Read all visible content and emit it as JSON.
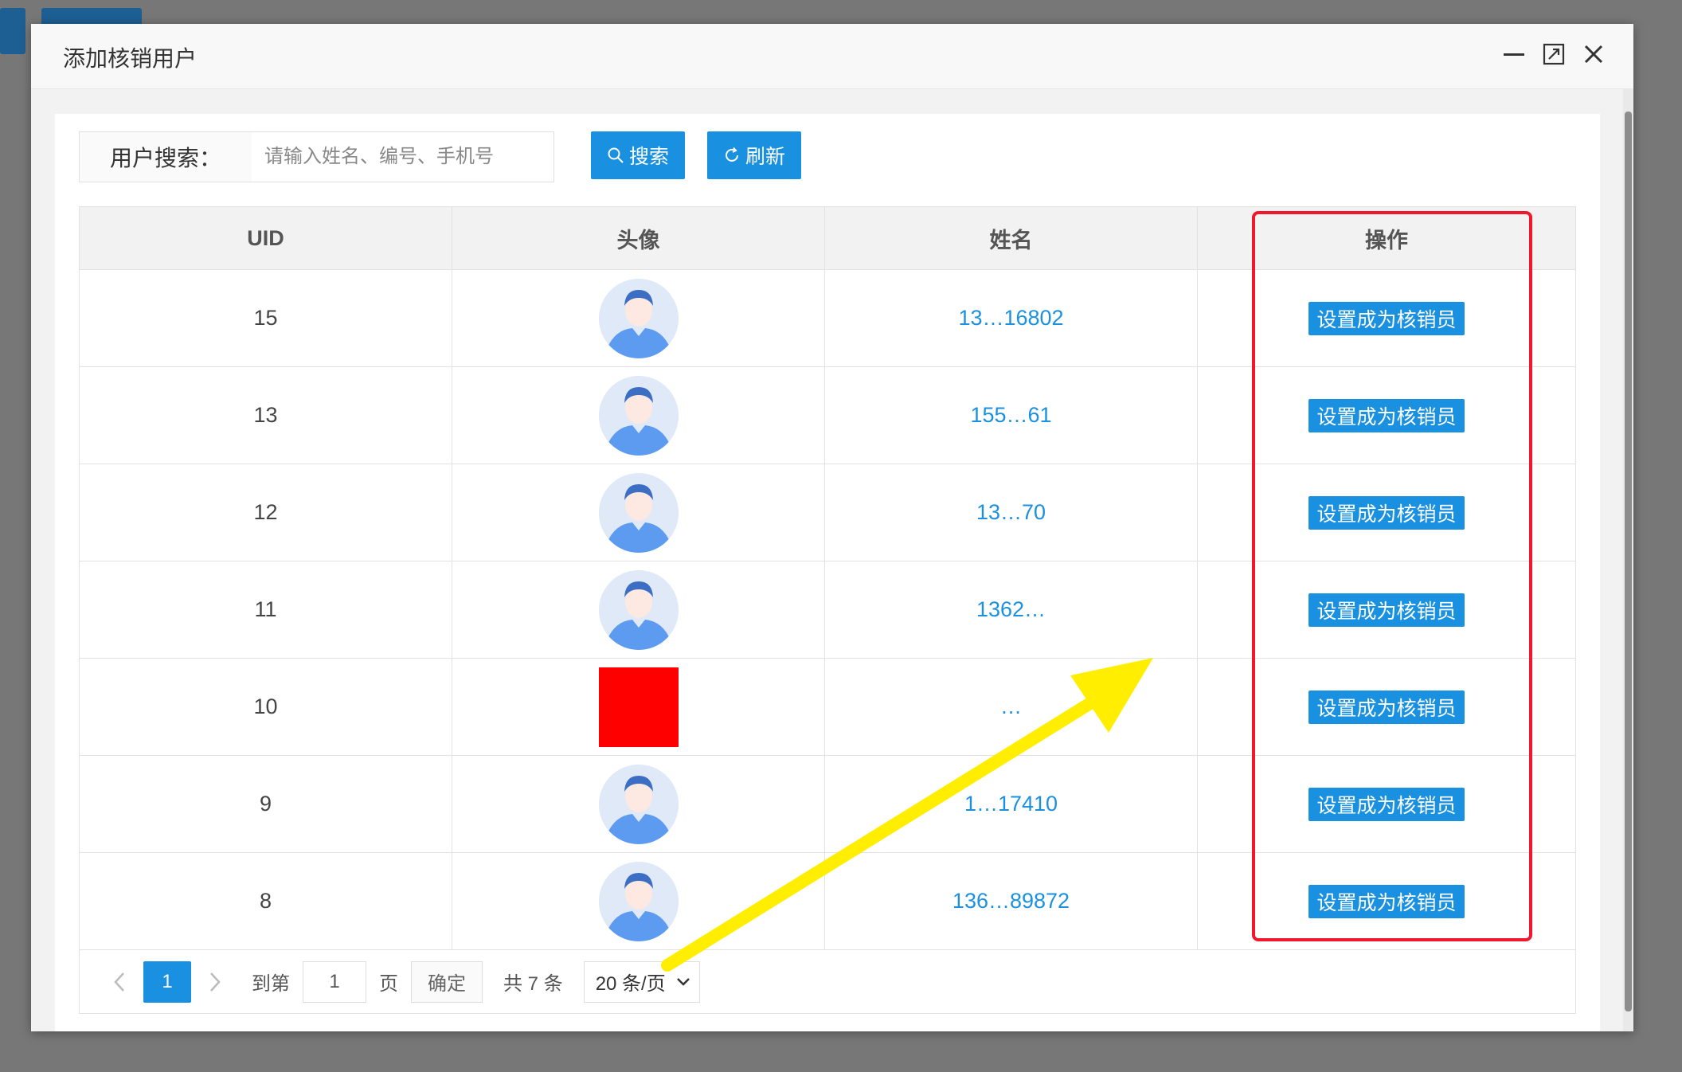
{
  "dialog": {
    "title": "添加核销用户"
  },
  "search": {
    "label": "用户搜索：",
    "placeholder": "请输入姓名、编号、手机号",
    "search_button": "搜索",
    "refresh_button": "刷新"
  },
  "table": {
    "headers": [
      "UID",
      "头像",
      "姓名",
      "操作"
    ],
    "rows": [
      {
        "uid": "15",
        "name": "13…16802",
        "action": "设置成为核销员"
      },
      {
        "uid": "13",
        "name": "155…61",
        "action": "设置成为核销员"
      },
      {
        "uid": "12",
        "name": "13…70",
        "action": "设置成为核销员"
      },
      {
        "uid": "11",
        "name": "1362…",
        "action": "设置成为核销员"
      },
      {
        "uid": "10",
        "name": "…",
        "action": "设置成为核销员"
      },
      {
        "uid": "9",
        "name": "1…17410",
        "action": "设置成为核销员"
      },
      {
        "uid": "8",
        "name": "136…89872",
        "action": "设置成为核销员"
      }
    ]
  },
  "pagination": {
    "current_page": "1",
    "goto_label": "到第",
    "goto_value": "1",
    "page_unit": "页",
    "confirm_label": "确定",
    "total": "共 7 条",
    "page_size": "20 条/页"
  },
  "colors": {
    "primary": "#1a91e0",
    "highlight": "#f2172c",
    "arrow": "#ffee00"
  },
  "icons": {
    "minimize": "minimize-icon",
    "maximize": "maximize-icon",
    "close": "close-icon",
    "search": "search-icon",
    "refresh": "refresh-icon",
    "prev": "chevron-left-icon",
    "next": "chevron-right-icon",
    "dropdown": "chevron-down-icon"
  }
}
